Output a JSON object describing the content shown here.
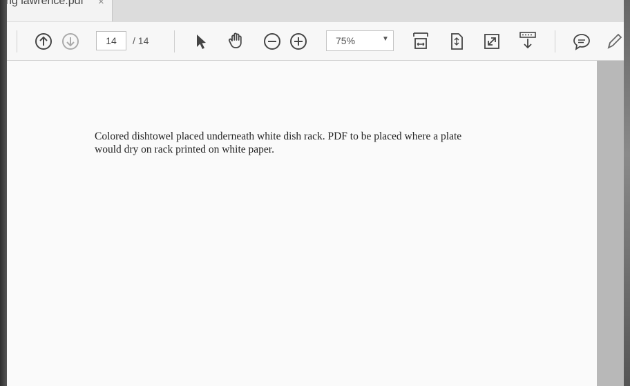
{
  "tab": {
    "title": "ng lawrence.pdf",
    "close_glyph": "×"
  },
  "toolbar": {
    "prev_page_icon": "arrow-up-circle-icon",
    "next_page_icon": "arrow-down-circle-icon",
    "current_page": "14",
    "total_pages": "/ 14",
    "select_tool_icon": "cursor-icon",
    "hand_tool_icon": "hand-icon",
    "zoom_out_icon": "zoom-out-icon",
    "zoom_in_icon": "zoom-in-icon",
    "zoom_level": "75%",
    "fit_width_icon": "fit-width-icon",
    "fit_page_icon": "fit-page-icon",
    "fullscreen_icon": "fullscreen-icon",
    "scroll_mode_icon": "scroll-mode-icon",
    "comment_icon": "comment-icon",
    "pen_icon": "pen-icon"
  },
  "document": {
    "line1": "Colored dishtowel placed underneath white dish rack. PDF to be placed where a plate",
    "line2": "would dry on rack printed on white paper."
  }
}
